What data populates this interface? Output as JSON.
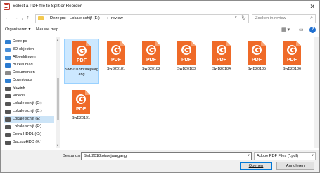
{
  "window": {
    "title": "Select a PDF file to Split or Reorder",
    "close_glyph": "✕"
  },
  "address_bar": {
    "back_glyph": "←",
    "forward_glyph": "→",
    "recent_glyph": "∨",
    "up_glyph": "↑",
    "crumbs": [
      "Deze pc",
      "Lokale schijf (E:)",
      "review"
    ],
    "separator": "›",
    "refresh_glyph": "↻",
    "dropdown_glyph": "∨"
  },
  "search": {
    "placeholder": "Zoeken in review",
    "icon": "search-icon",
    "glyph": "⌕"
  },
  "toolbar": {
    "organize_label": "Organiseren ▾",
    "new_folder_label": "Nieuwe map",
    "view_glyph": "▦ ▾",
    "pane_glyph": "▭",
    "help_glyph": "?"
  },
  "sidebar": {
    "items": [
      {
        "label": "Deze pc",
        "icon": "computer-icon",
        "color": "#2f7fd1"
      },
      {
        "label": "3D-objecten",
        "icon": "cube-icon",
        "color": "#4a90d9"
      },
      {
        "label": "Afbeeldingen",
        "icon": "images-icon",
        "color": "#3c8bd6"
      },
      {
        "label": "Bureaublad",
        "icon": "desktop-icon",
        "color": "#2a7ad0"
      },
      {
        "label": "Documenten",
        "icon": "document-icon",
        "color": "#8a8a8a"
      },
      {
        "label": "Downloads",
        "icon": "download-icon",
        "color": "#2f7fd1"
      },
      {
        "label": "Muziek",
        "icon": "music-icon",
        "color": "#555555"
      },
      {
        "label": "Video's",
        "icon": "video-icon",
        "color": "#555555"
      },
      {
        "label": "Lokale schijf (C:)",
        "icon": "drive-icon",
        "color": "#555555"
      },
      {
        "label": "Lokale schijf (D:)",
        "icon": "drive-icon",
        "color": "#555555"
      },
      {
        "label": "Lokale schijf (E:)",
        "icon": "drive-icon",
        "color": "#555555",
        "selected": true
      },
      {
        "label": "Lokale schijf (F:)",
        "icon": "drive-icon",
        "color": "#555555"
      },
      {
        "label": "Extra HDD1 (G:)",
        "icon": "drive-icon",
        "color": "#555555"
      },
      {
        "label": "BackupHDD (K:)",
        "icon": "drive-icon",
        "color": "#555555"
      }
    ]
  },
  "files": [
    {
      "name": "Swb2018totalejaargang",
      "icon_label": "PDF",
      "selected": true
    },
    {
      "name": "SwB20181",
      "icon_label": "PDF"
    },
    {
      "name": "SwB20182",
      "icon_label": "PDF"
    },
    {
      "name": "SwB20183",
      "icon_label": "PDF"
    },
    {
      "name": "SwB20184",
      "icon_label": "PDF"
    },
    {
      "name": "SwB20185",
      "icon_label": "PDF"
    },
    {
      "name": "SwB20186",
      "icon_label": "PDF"
    },
    {
      "name": "SwB20191",
      "icon_label": "PDF"
    }
  ],
  "footer": {
    "filename_label": "Bestandsnaam:",
    "filename_value": "Swb2018totalejaargang",
    "filetype_value": "Adobe PDF Files (*.pdf)",
    "dropdown_glyph": "∨",
    "open_label": "Openen",
    "cancel_label": "Annuleren"
  },
  "colors": {
    "pdf_orange": "#ef6a28",
    "selection": "#cce8ff",
    "accent": "#0078d7"
  }
}
